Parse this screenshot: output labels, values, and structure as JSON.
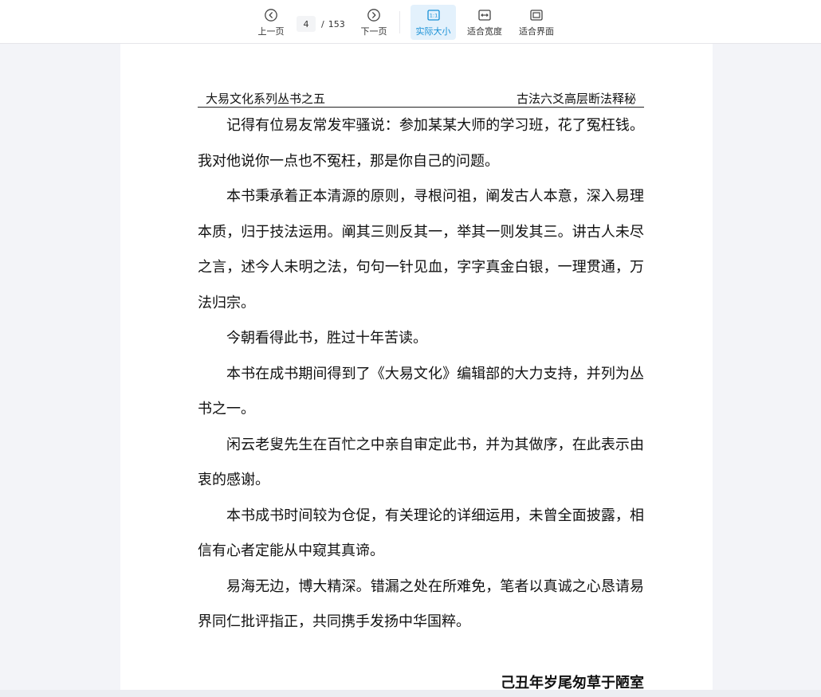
{
  "toolbar": {
    "prev_label": "上一页",
    "next_label": "下一页",
    "current_page": "4",
    "page_separator": "/",
    "total_pages": "153",
    "actual_size_label": "实际大小",
    "fit_width_label": "适合宽度",
    "fit_page_label": "适合界面",
    "active_mode": "actual-size",
    "accent_color": "#1890d6",
    "icons": {
      "prev": "chevron-left-circle-icon",
      "next": "chevron-right-circle-icon",
      "actual_size": "one-to-one-icon",
      "fit_width": "fit-width-icon",
      "fit_page": "fit-page-icon"
    }
  },
  "document": {
    "header_left": "大易文化系列丛书之五",
    "header_right": "古法六爻高层断法释秘",
    "paragraphs": [
      "记得有位易友常发牢骚说：参加某某大师的学习班，花了冤枉钱。我对他说你一点也不冤枉，那是你自己的问题。",
      "本书秉承着正本清源的原则，寻根问祖，阐发古人本意，深入易理本质，归于技法运用。阐其三则反其一，举其一则发其三。讲古人未尽之言，述今人未明之法，句句一针见血，字字真金白银，一理贯通，万法归宗。",
      "今朝看得此书，胜过十年苦读。",
      "本书在成书期间得到了《大易文化》编辑部的大力支持，并列为丛书之一。",
      "闲云老叟先生在百忙之中亲自审定此书，并为其做序，在此表示由衷的感谢。",
      "本书成书时间较为仓促，有关理论的详细运用，未曾全面披露，相信有心者定能从中窥其真谛。",
      "易海无边，博大精深。错漏之处在所难免，笔者以真诚之心恳请易界同仁批评指正，共同携手发扬中华国粹。"
    ],
    "signature": "己丑年岁尾匆草于陋室"
  }
}
